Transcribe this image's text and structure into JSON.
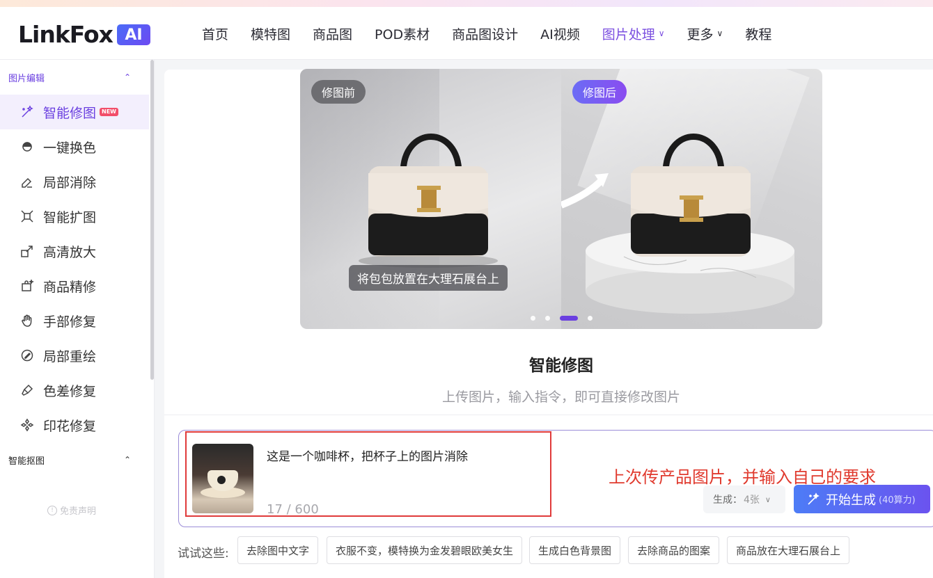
{
  "brand": {
    "name": "LinkFox",
    "badge": "AI"
  },
  "nav": [
    {
      "label": "首页"
    },
    {
      "label": "模特图"
    },
    {
      "label": "商品图"
    },
    {
      "label": "POD素材"
    },
    {
      "label": "商品图设计"
    },
    {
      "label": "AI视频"
    },
    {
      "label": "图片处理",
      "active": true,
      "has_dropdown": true
    },
    {
      "label": "更多",
      "has_dropdown": true
    },
    {
      "label": "教程"
    }
  ],
  "sidebar": {
    "group1": "图片编辑",
    "items": [
      {
        "label": "智能修图",
        "icon": "magic-wand-icon",
        "active": true,
        "badge": "NEW"
      },
      {
        "label": "一键换色",
        "icon": "color-swap-icon"
      },
      {
        "label": "局部消除",
        "icon": "eraser-icon"
      },
      {
        "label": "智能扩图",
        "icon": "expand-icon"
      },
      {
        "label": "高清放大",
        "icon": "upscale-icon"
      },
      {
        "label": "商品精修",
        "icon": "product-retouch-icon"
      },
      {
        "label": "手部修复",
        "icon": "hand-icon"
      },
      {
        "label": "局部重绘",
        "icon": "repaint-icon"
      },
      {
        "label": "色差修复",
        "icon": "color-fix-icon"
      },
      {
        "label": "印花修复",
        "icon": "print-fix-icon"
      }
    ],
    "group2": "智能抠图",
    "disclaimer": "免责声明"
  },
  "banner": {
    "before_tag": "修图前",
    "after_tag": "修图后",
    "caption": "将包包放置在大理石展台上",
    "slides": 4,
    "active_slide": 3
  },
  "tool": {
    "title": "智能修图",
    "subtitle": "上传图片，输入指令，即可直接修改图片"
  },
  "prompt": {
    "text": "这是一个咖啡杯，把杯子上的图片消除",
    "counter": "17 / 600"
  },
  "annotation": "上次传产品图片，并输入自己的要求",
  "generate": {
    "count_label": "生成：",
    "count_value": "4张",
    "button_label": "开始生成",
    "button_cost": "(40算力)"
  },
  "suggestions": {
    "label": "试试这些:",
    "chips": [
      "去除图中文字",
      "衣服不变，模特换为金发碧眼欧美女生",
      "生成白色背景图",
      "去除商品的图案",
      "商品放在大理石展台上"
    ]
  },
  "colors": {
    "accent": "#6a3fe0",
    "annotation_red": "#e03a2e",
    "button_start": "#4d7cf6",
    "button_end": "#6b53ef"
  }
}
